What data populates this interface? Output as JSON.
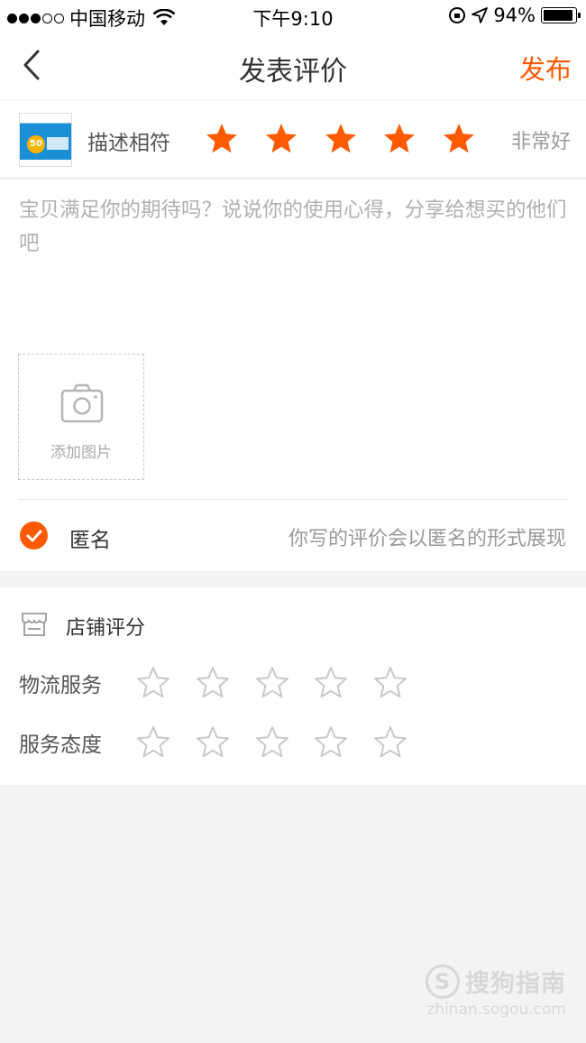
{
  "status_bar": {
    "carrier": "中国移动",
    "time": "下午9:10",
    "battery": "94%",
    "battery_level": 0.94
  },
  "nav": {
    "title": "发表评价",
    "publish_label": "发布"
  },
  "product": {
    "desc_label": "描述相符",
    "rating": 5,
    "rating_text": "非常好",
    "thumb_value": "50"
  },
  "review": {
    "placeholder": "宝贝满足你的期待吗？说说你的使用心得，分享给想买的他们吧",
    "add_photo_label": "添加图片"
  },
  "anonymous": {
    "label": "匿名",
    "checked": true,
    "hint": "你写的评价会以匿名的形式展现"
  },
  "shop_rating": {
    "title": "店铺评分",
    "rows": [
      {
        "label": "物流服务",
        "rating": 0
      },
      {
        "label": "服务态度",
        "rating": 0
      }
    ]
  },
  "colors": {
    "accent": "#ff5a00",
    "star_empty": "#c8c8c8"
  },
  "watermark": {
    "logo": "S",
    "text": "搜狗指南",
    "url": "zhinan.sogou.com"
  }
}
